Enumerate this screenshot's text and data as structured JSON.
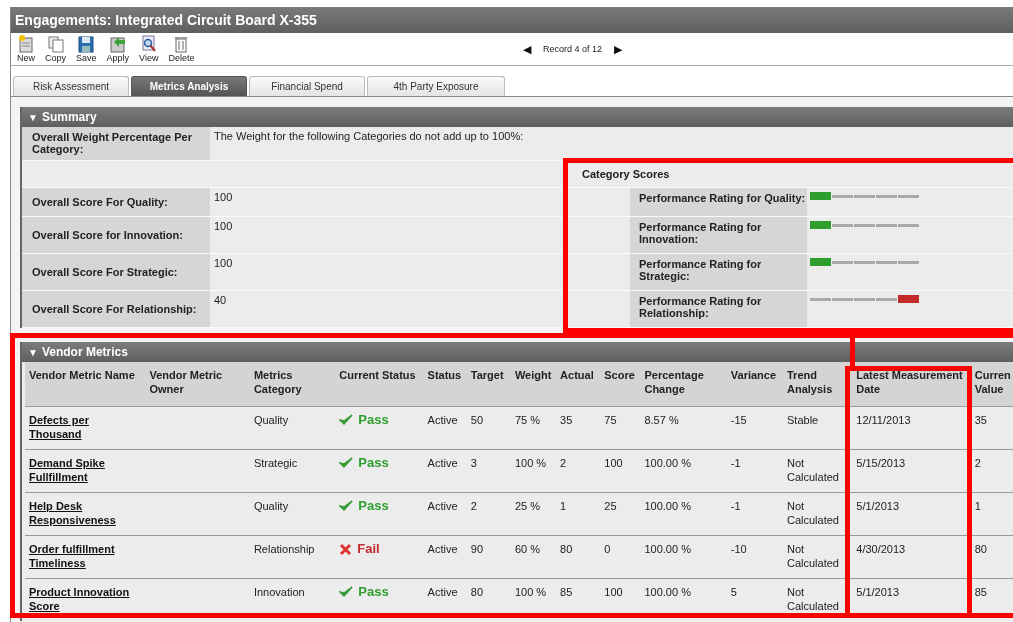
{
  "window": {
    "title": "Engagements: Integrated Circuit Board X-355"
  },
  "toolbar": [
    {
      "label": "New",
      "kind": "new"
    },
    {
      "label": "Copy",
      "kind": "copy"
    },
    {
      "label": "Save",
      "kind": "save"
    },
    {
      "label": "Apply",
      "kind": "apply"
    },
    {
      "label": "View",
      "kind": "view"
    },
    {
      "label": "Delete",
      "kind": "delete"
    }
  ],
  "pager": {
    "prev": "◀",
    "text": "Record 4 of 12",
    "next": "▶"
  },
  "tabs": [
    {
      "label": "Risk Assessment",
      "selected": false
    },
    {
      "label": "Metrics Analysis",
      "selected": true
    },
    {
      "label": "Financial Spend",
      "selected": false
    },
    {
      "label": "4th Party Exposure",
      "selected": false
    }
  ],
  "summary": {
    "toggle": "▼",
    "title": "Summary",
    "weight_label": "Overall Weight Percentage Per Category:",
    "weight_text": "The Weight for the following Categories do not add up to 100%:",
    "category_scores_title": "Category Scores",
    "scores": [
      {
        "label": "Overall Score For Quality:",
        "value": "100"
      },
      {
        "label": "Overall Score for Innovation:",
        "value": "100"
      },
      {
        "label": "Overall Score For Strategic:",
        "value": "100"
      },
      {
        "label": "Overall Score For Relationship:",
        "value": "40"
      }
    ],
    "ratings": [
      {
        "label": "Performance Rating for Quality:",
        "level": 0.2,
        "color": "#2e9e2e"
      },
      {
        "label": "Performance Rating for Innovation:",
        "level": 0.2,
        "color": "#2e9e2e"
      },
      {
        "label": "Performance Rating for Strategic:",
        "level": 0.2,
        "color": "#2e9e2e"
      },
      {
        "label": "Performance Rating for Relationship:",
        "level": 1.0,
        "color": "#c42a2a"
      }
    ]
  },
  "vendor_metrics": {
    "toggle": "▼",
    "title": "Vendor Metrics",
    "columns": [
      "Vendor Metric Name",
      "Vendor Metric Owner",
      "Metrics Category",
      "Current Status",
      "Status",
      "Target",
      "Weight",
      "Actual",
      "Score",
      "Percentage Change",
      "Variance",
      "Trend Analysis",
      "Latest Measurement Date",
      "Curren Value"
    ],
    "rows": [
      {
        "name": "Defects per Thousand",
        "category": "Quality",
        "result": {
          "kind": "pass",
          "text": "Pass"
        },
        "status": "Active",
        "target": "50",
        "weight": "75 %",
        "actual": "35",
        "score": "75",
        "change": "8.57 %",
        "variance": "-15",
        "trend": "Stable",
        "date": "12/11/2013",
        "current": "35"
      },
      {
        "name": "Demand Spike Fullfillment",
        "category": "Strategic",
        "result": {
          "kind": "pass",
          "text": "Pass"
        },
        "status": "Active",
        "target": "3",
        "weight": "100 %",
        "actual": "2",
        "score": "100",
        "change": "100.00 %",
        "variance": "-1",
        "trend": "Not Calculated",
        "date": "5/15/2013",
        "current": "2"
      },
      {
        "name": "Help Desk Responsiveness",
        "category": "Quality",
        "result": {
          "kind": "pass",
          "text": "Pass"
        },
        "status": "Active",
        "target": "2",
        "weight": "25 %",
        "actual": "1",
        "score": "25",
        "change": "100.00 %",
        "variance": "-1",
        "trend": "Not Calculated",
        "date": "5/1/2013",
        "current": "1"
      },
      {
        "name": "Order fulfillment Timeliness",
        "category": "Relationship",
        "result": {
          "kind": "fail",
          "text": "Fail"
        },
        "status": "Active",
        "target": "90",
        "weight": "60 %",
        "actual": "80",
        "score": "0",
        "change": "100.00 %",
        "variance": "-10",
        "trend": "Not Calculated",
        "date": "4/30/2013",
        "current": "80"
      },
      {
        "name": "Product Innovation Score",
        "category": "Innovation",
        "result": {
          "kind": "pass",
          "text": "Pass"
        },
        "status": "Active",
        "target": "80",
        "weight": "100 %",
        "actual": "85",
        "score": "100",
        "change": "100.00 %",
        "variance": "5",
        "trend": "Not Calculated",
        "date": "5/1/2013",
        "current": "85"
      }
    ]
  }
}
